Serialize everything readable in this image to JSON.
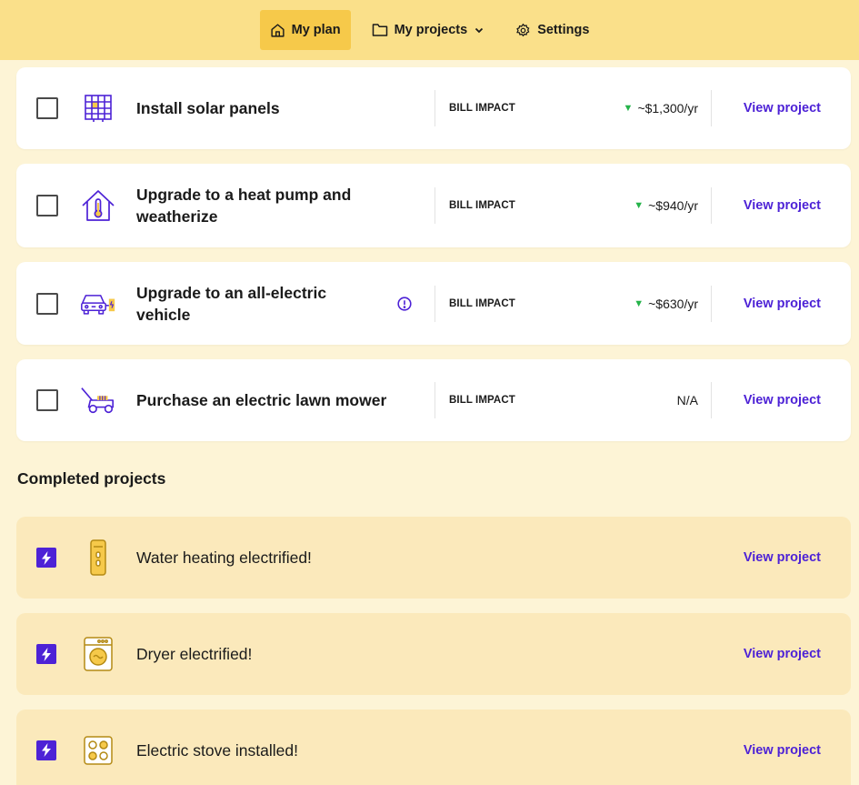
{
  "nav": {
    "items": [
      {
        "label": "My plan",
        "icon": "home-icon",
        "active": true
      },
      {
        "label": "My projects",
        "icon": "folder-icon",
        "dropdown": "chevron-down-icon"
      },
      {
        "label": "Settings",
        "icon": "gear-icon"
      }
    ]
  },
  "projects": [
    {
      "title": "Install solar panels",
      "icon": "solar-panel-icon",
      "bill_label": "BILL IMPACT",
      "bill_value": "~$1,300/yr",
      "arrow": "▼",
      "link": "View project"
    },
    {
      "title": "Upgrade to a heat pump and weatherize",
      "icon": "heat-pump-house-icon",
      "bill_label": "BILL IMPACT",
      "bill_value": "~$940/yr",
      "arrow": "▼",
      "link": "View project"
    },
    {
      "title": "Upgrade to an all-electric vehicle",
      "icon": "electric-vehicle-icon",
      "bill_label": "BILL IMPACT",
      "bill_value": "~$630/yr",
      "arrow": "▼",
      "info_icon": "info-icon",
      "link": "View project"
    },
    {
      "title": "Purchase an electric lawn mower",
      "icon": "lawn-mower-icon",
      "bill_label": "BILL IMPACT",
      "bill_value": "N/A",
      "link": "View project"
    }
  ],
  "completed": {
    "title": "Completed projects",
    "items": [
      {
        "title": "Water heating electrified!",
        "icon": "water-heater-icon",
        "link": "View project"
      },
      {
        "title": "Dryer electrified!",
        "icon": "dryer-icon",
        "link": "View project"
      },
      {
        "title": "Electric stove installed!",
        "icon": "stove-icon",
        "link": "View project"
      }
    ]
  },
  "colors": {
    "accent": "#4d22d6",
    "nav_bg": "#fae08a",
    "nav_active": "#f6c94a",
    "page_bg": "#fdf4d6",
    "completed_bg": "#fbe9bb",
    "savings_green": "#25b34a"
  }
}
